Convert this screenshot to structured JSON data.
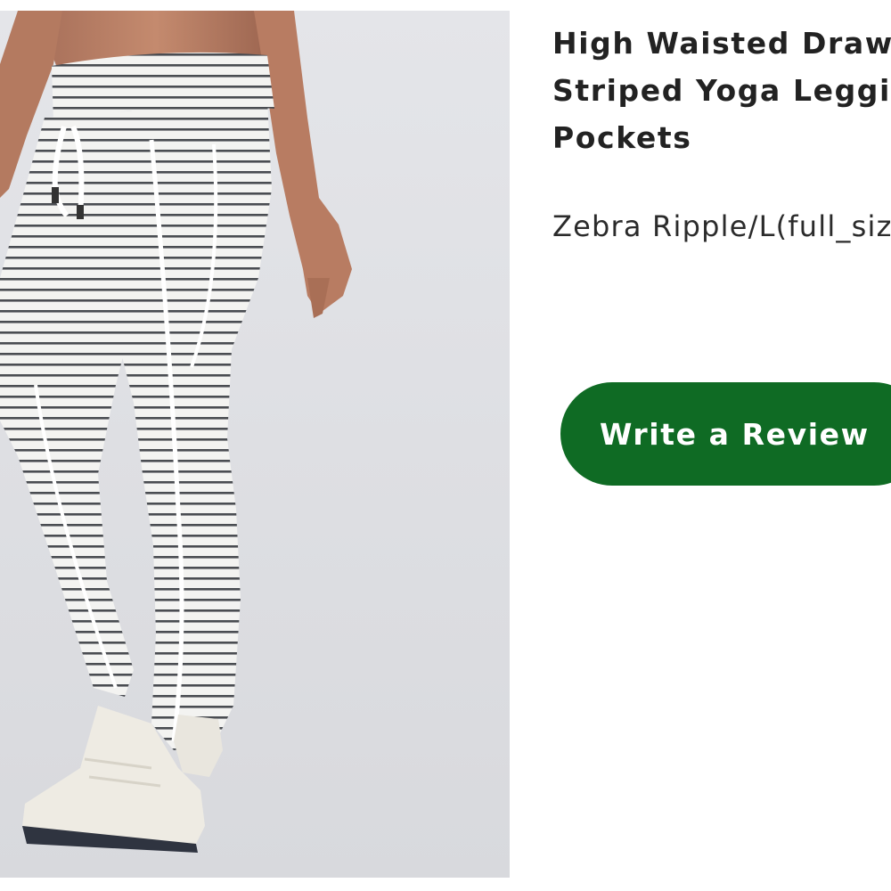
{
  "product": {
    "title": "High Waisted Drawstring\nStriped Yoga Leggings with\nPockets",
    "variant": "Zebra Ripple/L(full_size)",
    "image_alt": "Model wearing white striped high waisted leggings and white sneakers"
  },
  "actions": {
    "write_review_label": "Write a Review"
  },
  "colors": {
    "accent": "#0f6b24",
    "photo_background": "#dedfe3",
    "title_text": "#222222"
  }
}
